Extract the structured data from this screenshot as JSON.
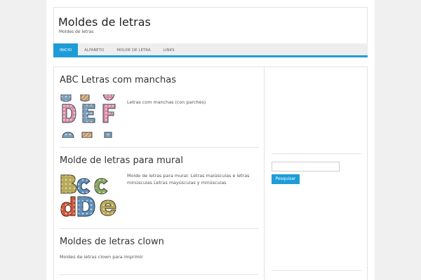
{
  "header": {
    "site_title": "Moldes de letras",
    "site_description": "Moldes de letras"
  },
  "nav": {
    "items": [
      {
        "label": "INICIO"
      },
      {
        "label": "ALFABETO"
      },
      {
        "label": "MOLDE DE LETRA"
      },
      {
        "label": "LINKS"
      }
    ]
  },
  "posts": [
    {
      "title": "ABC Letras com manchas",
      "excerpt": "Letras com manchas (con parches)",
      "thumbnail_icon": "patched-letters-image"
    },
    {
      "title": "Molde de letras para mural",
      "excerpt": "Molde de letras para mural: Letras maiúsculas e letras minúsculas Letras mayúsculas y minúsculas",
      "thumbnail_icon": "mural-letters-image"
    },
    {
      "title": "Moldes de letras clown",
      "excerpt": "Moldes de letras clown para imprimir"
    }
  ],
  "sidebar": {
    "search_placeholder": "",
    "search_button_label": "Pesquisar"
  },
  "colors": {
    "accent": "#1e9cd8",
    "background": "#f0f0f0"
  }
}
